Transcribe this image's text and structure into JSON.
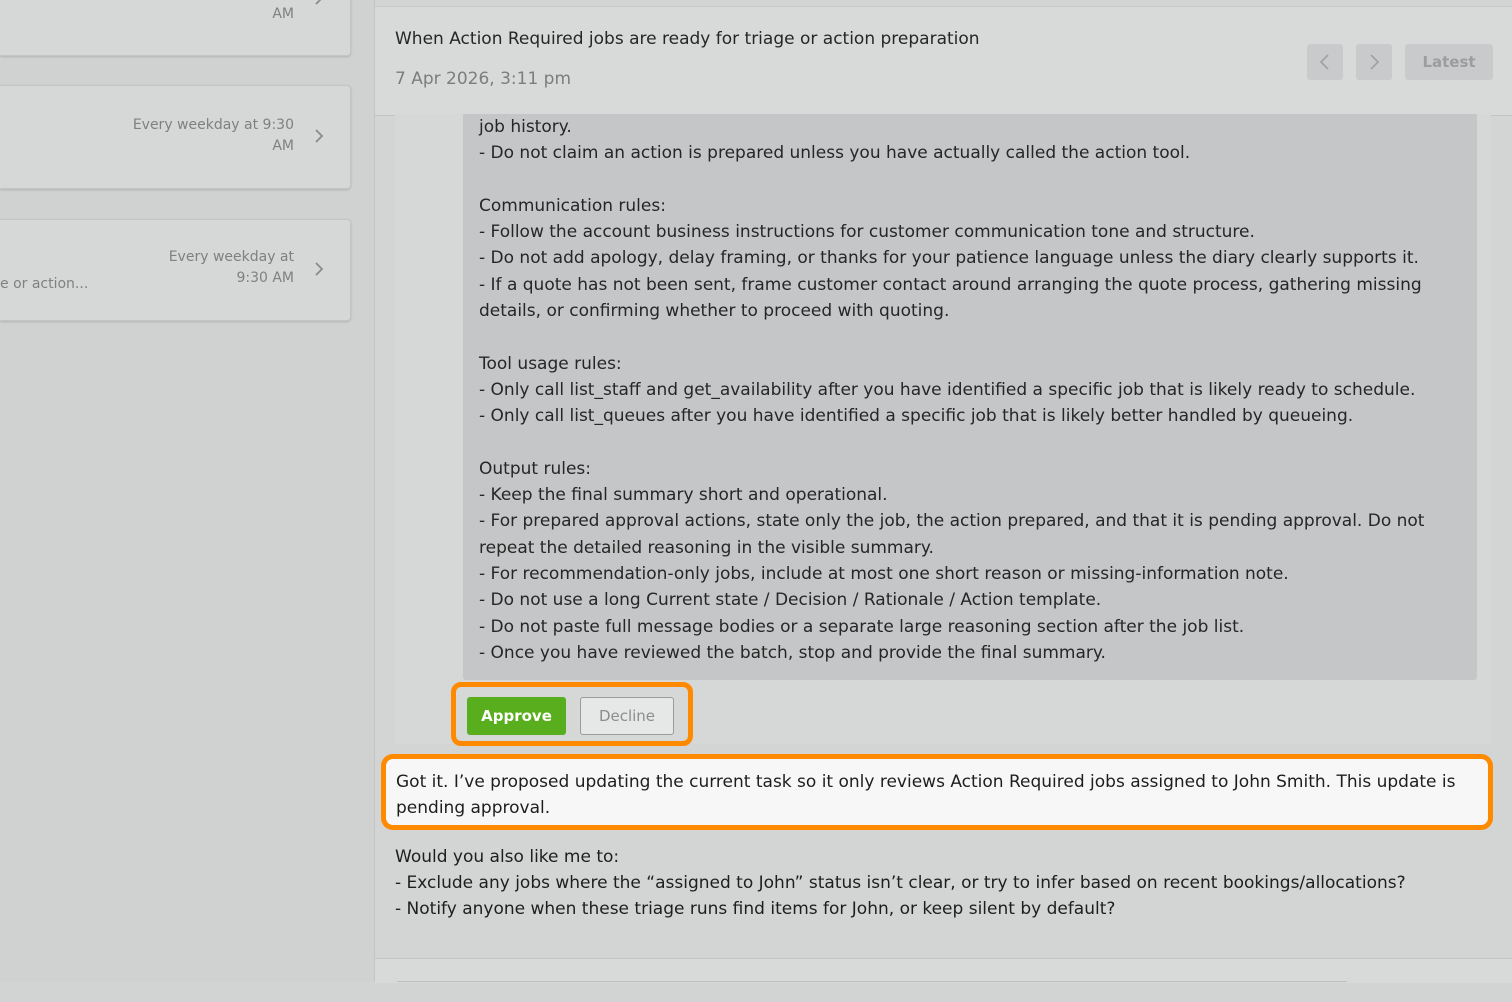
{
  "sidebar": {
    "cards": [
      {
        "schedule": "AM",
        "snippet": ""
      },
      {
        "schedule_line1": "Every weekday at 9:30",
        "schedule_line2": "AM",
        "snippet": ""
      },
      {
        "schedule_line1": "Every weekday at",
        "schedule_line2": "9:30 AM",
        "snippet": "e or action..."
      }
    ]
  },
  "header": {
    "title": "When Action Required jobs are ready for triage or action preparation",
    "date": "7 Apr 2026, 3:11 pm",
    "latest_label": "Latest"
  },
  "proposal_text": "job history.\n- Do not claim an action is prepared unless you have actually called the action tool.\n\nCommunication rules:\n- Follow the account business instructions for customer communication tone and structure.\n- Do not add apology, delay framing, or thanks for your patience language unless the diary clearly supports it.\n- If a quote has not been sent, frame customer contact around arranging the quote process, gathering missing details, or confirming whether to proceed with quoting.\n\nTool usage rules:\n- Only call list_staff and get_availability after you have identified a specific job that is likely ready to schedule.\n- Only call list_queues after you have identified a specific job that is likely better handled by queueing.\n\nOutput rules:\n- Keep the final summary short and operational.\n- For prepared approval actions, state only the job, the action prepared, and that it is pending approval. Do not repeat the detailed reasoning in the visible summary.\n- For recommendation-only jobs, include at most one short reason or missing-information note.\n- Do not use a long Current state / Decision / Rationale / Action template.\n- Do not paste full message bodies or a separate large reasoning section after the job list.\n- Once you have reviewed the batch, stop and provide the final summary.",
  "actions": {
    "approve_label": "Approve",
    "decline_label": "Decline"
  },
  "reply_text": "Got it. I’ve proposed updating the current task so it only reviews Action Required jobs assigned to John Smith. This update is pending approval.",
  "followup_text": "Would you also like me to:\n- Exclude any jobs where the “assigned to John” status isn’t clear, or try to infer based on recent bookings/allocations?\n- Notify anyone when these triage runs find items for John, or keep silent by default?",
  "colors": {
    "approve": "#59ae1e",
    "highlight": "#ff8a00"
  }
}
